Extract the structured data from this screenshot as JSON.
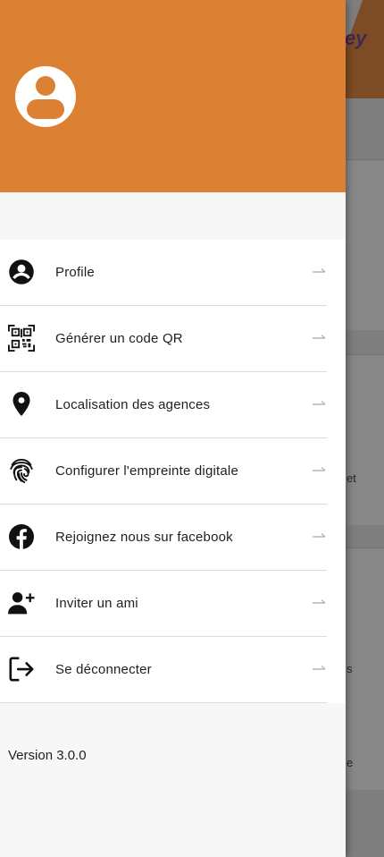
{
  "background": {
    "logo_text": "ey",
    "snippets": [
      "et",
      "s",
      "e"
    ]
  },
  "drawer": {
    "menu": [
      {
        "label": "Profile",
        "icon": "account-circle-icon"
      },
      {
        "label": "Générer un code QR",
        "icon": "qr-code-icon"
      },
      {
        "label": "Localisation des agences",
        "icon": "location-pin-icon"
      },
      {
        "label": "Configurer l'empreinte digitale",
        "icon": "fingerprint-icon"
      },
      {
        "label": "Rejoignez nous sur facebook",
        "icon": "facebook-icon"
      },
      {
        "label": "Inviter un ami",
        "icon": "person-add-icon"
      },
      {
        "label": "Se déconnecter",
        "icon": "logout-icon"
      }
    ],
    "version": "Version 3.0.0"
  },
  "colors": {
    "header": "#dc8134",
    "icon": "#111111",
    "arrow": "#b5b5b5"
  }
}
